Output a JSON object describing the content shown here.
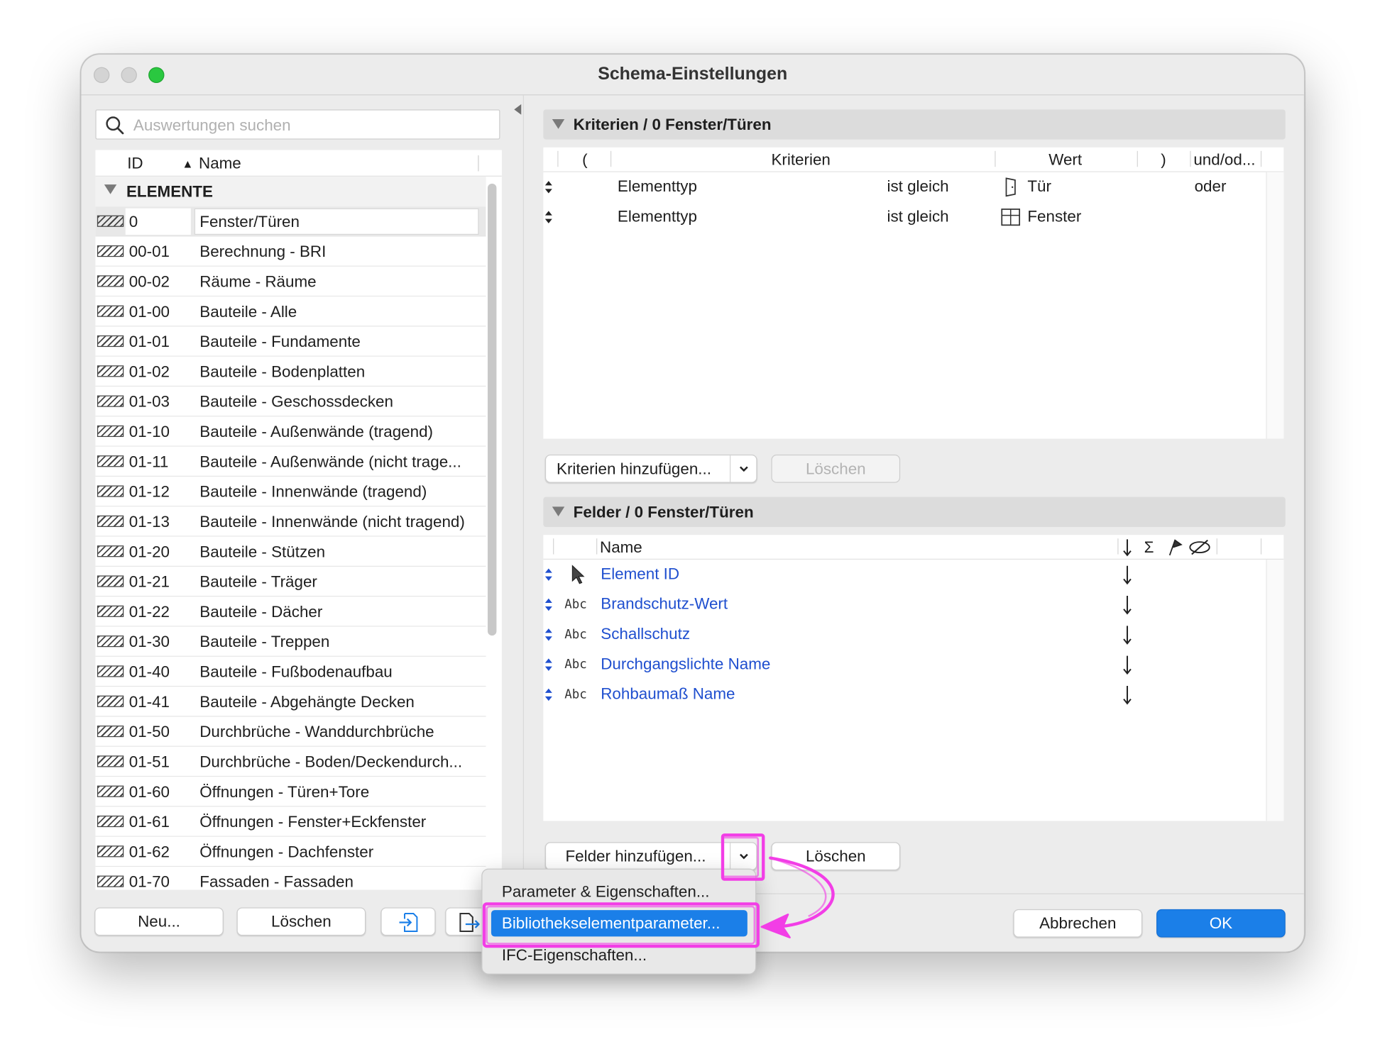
{
  "window": {
    "title": "Schema-Einstellungen"
  },
  "left": {
    "search_placeholder": "Auswertungen suchen",
    "col_id": "ID",
    "col_name": "Name",
    "group": "ELEMENTE",
    "rows": [
      {
        "id": "0",
        "name": "Fenster/Türen"
      },
      {
        "id": "00-01",
        "name": "Berechnung - BRI"
      },
      {
        "id": "00-02",
        "name": "Räume - Räume"
      },
      {
        "id": "01-00",
        "name": "Bauteile - Alle"
      },
      {
        "id": "01-01",
        "name": "Bauteile - Fundamente"
      },
      {
        "id": "01-02",
        "name": "Bauteile - Bodenplatten"
      },
      {
        "id": "01-03",
        "name": "Bauteile - Geschossdecken"
      },
      {
        "id": "01-10",
        "name": "Bauteile - Außenwände (tragend)"
      },
      {
        "id": "01-11",
        "name": "Bauteile - Außenwände (nicht trage..."
      },
      {
        "id": "01-12",
        "name": "Bauteile - Innenwände (tragend)"
      },
      {
        "id": "01-13",
        "name": "Bauteile - Innenwände (nicht tragend)"
      },
      {
        "id": "01-20",
        "name": "Bauteile - Stützen"
      },
      {
        "id": "01-21",
        "name": "Bauteile - Träger"
      },
      {
        "id": "01-22",
        "name": "Bauteile - Dächer"
      },
      {
        "id": "01-30",
        "name": "Bauteile - Treppen"
      },
      {
        "id": "01-40",
        "name": "Bauteile - Fußbodenaufbau"
      },
      {
        "id": "01-41",
        "name": "Bauteile - Abgehängte Decken"
      },
      {
        "id": "01-50",
        "name": "Durchbrüche - Wanddurchbrüche"
      },
      {
        "id": "01-51",
        "name": "Durchbrüche - Boden/Deckendurch..."
      },
      {
        "id": "01-60",
        "name": "Öffnungen - Türen+Tore"
      },
      {
        "id": "01-61",
        "name": "Öffnungen - Fenster+Eckfenster"
      },
      {
        "id": "01-62",
        "name": "Öffnungen - Dachfenster"
      },
      {
        "id": "01-70",
        "name": "Fassaden - Fassaden"
      }
    ],
    "btn_new": "Neu...",
    "btn_delete": "Löschen"
  },
  "criteria": {
    "header": "Kriterien / 0 Fenster/Türen",
    "col_open": "(",
    "col_criteria": "Kriterien",
    "col_value": "Wert",
    "col_close": ")",
    "col_andor": "und/od...",
    "rows": [
      {
        "criterion": "Elementtyp",
        "op": "ist gleich",
        "value": "Tür",
        "andor": "oder"
      },
      {
        "criterion": "Elementtyp",
        "op": "ist gleich",
        "value": "Fenster",
        "andor": ""
      }
    ],
    "btn_add": "Kriterien hinzufügen...",
    "btn_delete": "Löschen"
  },
  "fields": {
    "header": "Felder / 0 Fenster/Türen",
    "col_name": "Name",
    "col_sum": "Σ",
    "type_abc": "Abc",
    "rows": [
      {
        "name": "Element ID",
        "type": "pointer"
      },
      {
        "name": "Brandschutz-Wert",
        "type": "abc"
      },
      {
        "name": "Schallschutz",
        "type": "abc"
      },
      {
        "name": "Durchgangslichte Name",
        "type": "abc"
      },
      {
        "name": "Rohbaumaß Name",
        "type": "abc"
      }
    ],
    "btn_add": "Felder hinzufügen...",
    "btn_delete": "Löschen"
  },
  "menu": {
    "items": [
      {
        "label": "Parameter & Eigenschaften..."
      },
      {
        "label": "Bibliothekselementparameter..."
      },
      {
        "label": "IFC-Eigenschaften..."
      }
    ]
  },
  "footer": {
    "cancel": "Abbrechen",
    "ok": "OK"
  },
  "colors": {
    "accent": "#1b7fe8",
    "link": "#1f4fcf",
    "annotation": "#f23ee6",
    "close_light": "#2ac840"
  }
}
